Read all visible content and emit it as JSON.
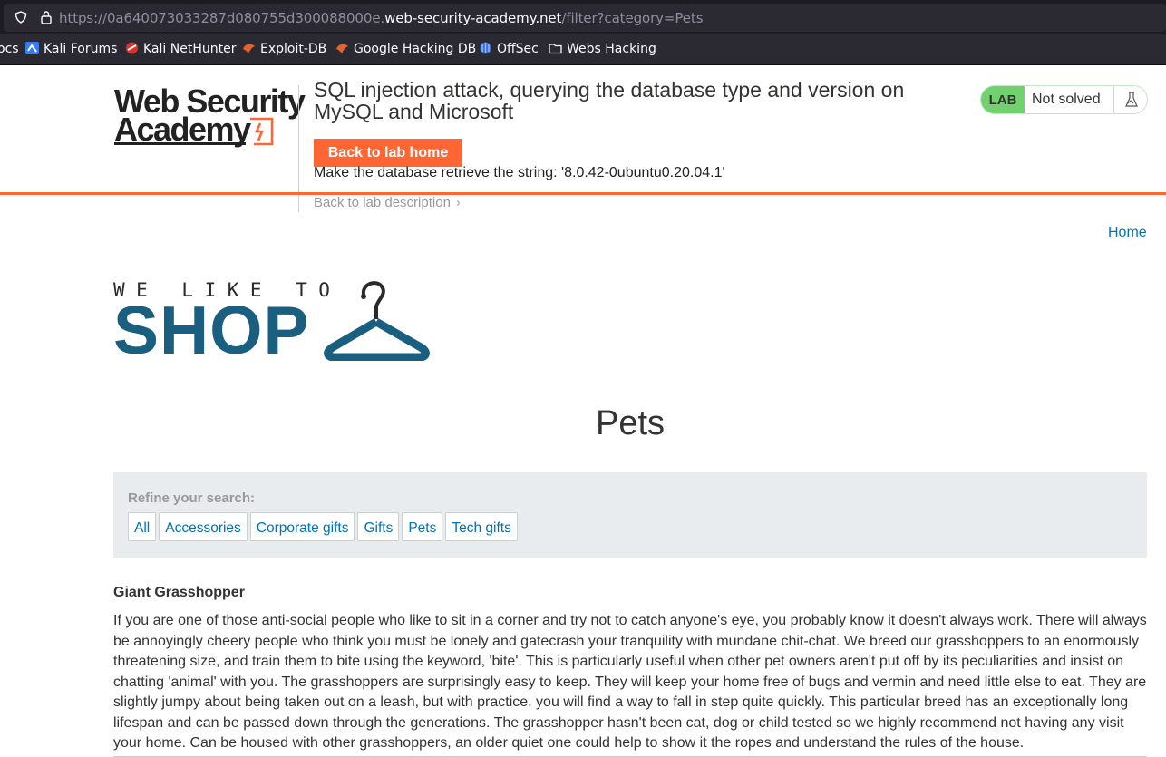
{
  "browser": {
    "url_prefix": "https://0a640073033287d080755d300088000e.",
    "url_host": "web-security-academy.net",
    "url_path": "/filter?category=Pets",
    "bookmarks": [
      {
        "label": "ocs",
        "icon": "truncated-bookmark"
      },
      {
        "label": "Kali Forums",
        "icon": "kali-forums-icon"
      },
      {
        "label": "Kali NetHunter",
        "icon": "kali-nethunter-icon"
      },
      {
        "label": "Exploit-DB",
        "icon": "exploit-db-icon"
      },
      {
        "label": "Google Hacking DB",
        "icon": "ghdb-icon"
      },
      {
        "label": "OffSec",
        "icon": "offsec-icon"
      },
      {
        "label": "Webs Hacking",
        "icon": "folder-icon"
      }
    ]
  },
  "lab_header": {
    "logo_line1": "Web Security",
    "logo_line2": "Academy",
    "title": "SQL injection attack, querying the database type and version on MySQL and Microsoft",
    "back_button": "Back to lab home",
    "instruction": "Make the database retrieve the string: '8.0.42-0ubuntu0.20.04.1'",
    "back_description": "Back to lab description",
    "badge": "LAB",
    "status": "Not solved",
    "colors": {
      "accent": "#ff6633",
      "badge": "#70d16d",
      "link": "#0071bc"
    }
  },
  "nav": {
    "home": "Home"
  },
  "shop_logo": {
    "tagline": "WE LIKE TO",
    "word": "SHOP"
  },
  "page": {
    "heading": "Pets",
    "refine_label": "Refine your search:",
    "filters": [
      "All",
      "Accessories",
      "Corporate gifts",
      "Gifts",
      "Pets",
      "Tech gifts"
    ]
  },
  "product": {
    "name": "Giant Grasshopper",
    "description": "If you are one of those anti-social people who like to sit in a corner and try not to catch anyone's eye, you probably know it doesn't always work. There will always be annoyingly cheery people who think you must be lonely and gatecrash your tranquility with mundane chit-chat. We breed our grasshoppers to an enormously threatening size, and train them to bite using the keyword, 'bite'. This is particularly useful when other pet owners aren't put off by its peculiarities and insist on chatting 'animal' with you. The grasshoppers are surprisingly easy to keep. They will keep your home free of bugs and vermin and need little else to eat. They are slightly jumpy about being taken out on a leash, but with practice, you will find a way to fall in step quite quickly. This particular breed has an exceptionally long lifespan and can be passed down through the generations. The grasshopper hasn't been cat, dog or child tested so we highly recommend not having any visit your home. Can be housed with other grasshoppers, an older quiet one could help to show it the ropes and understand the rules of the house."
  }
}
